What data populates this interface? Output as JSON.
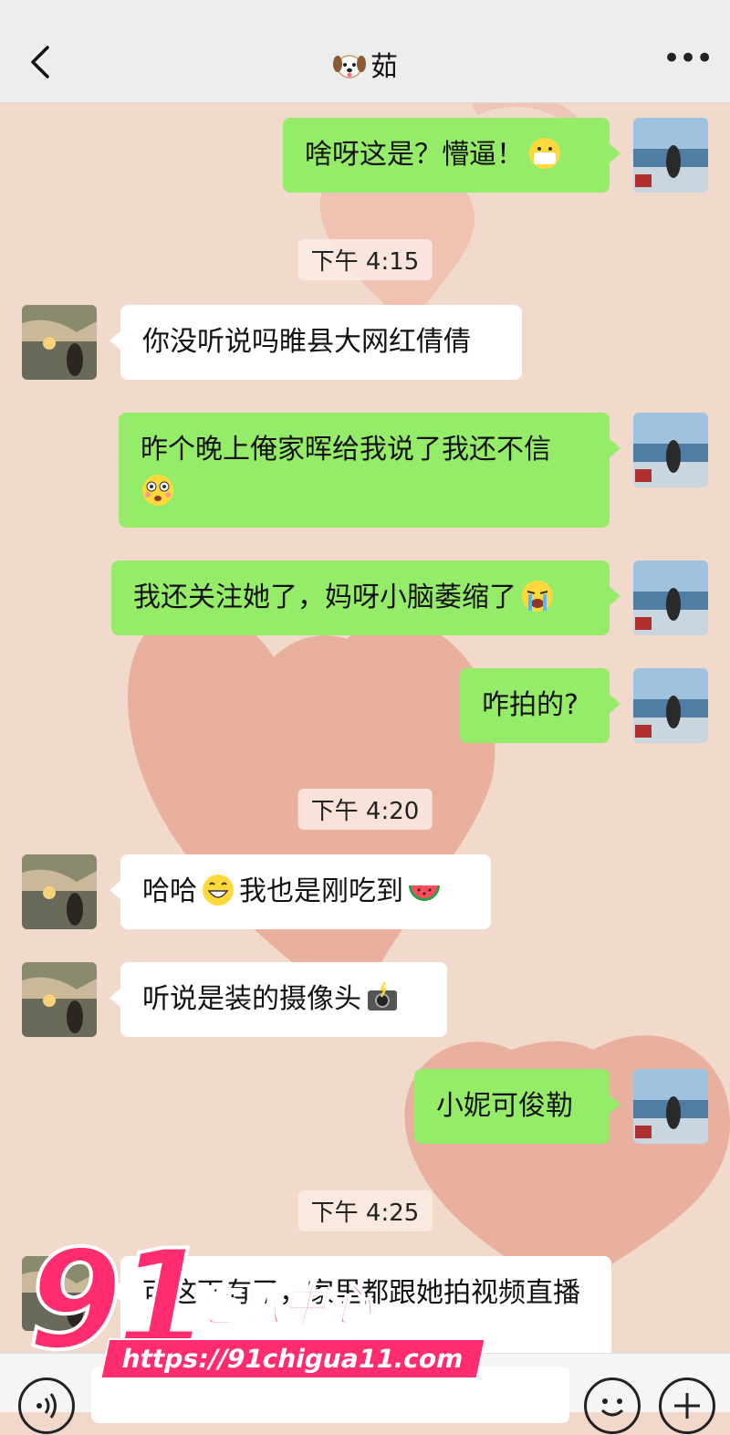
{
  "header": {
    "title": "茹",
    "title_icon": "dog-face-icon",
    "back_icon": "chevron-left-icon",
    "more_icon": "more-horizontal-icon"
  },
  "messages": [
    {
      "type": "out",
      "text": "啥呀这是？懵逼！",
      "emoji": "mask-face-emoji"
    },
    {
      "type": "time",
      "text": "下午 4:15"
    },
    {
      "type": "in",
      "text": "你没听说吗睢县大网红倩倩"
    },
    {
      "type": "out",
      "text": "昨个晚上俺家晖给我说了我还不信",
      "emoji": "flushed-face-emoji"
    },
    {
      "type": "out",
      "text": "我还关注她了，妈呀小脑萎缩了",
      "emoji": "crying-face-emoji"
    },
    {
      "type": "out",
      "text": "咋拍的?"
    },
    {
      "type": "time",
      "text": "下午 4:20"
    },
    {
      "type": "in",
      "text_before": "哈哈",
      "emoji_mid": "grinning-face-emoji",
      "text_after": "我也是刚吃到",
      "emoji": "watermelon-emoji"
    },
    {
      "type": "in",
      "text": "听说是装的摄像头",
      "emoji": "camera-flash-emoji"
    },
    {
      "type": "out",
      "text": "小妮可俊勒"
    },
    {
      "type": "time",
      "text": "下午 4:25"
    },
    {
      "type": "in",
      "text": "可这下有了，家里都跟她拍视频直播"
    }
  ],
  "bottom": {
    "voice_icon": "voice-icon",
    "emoji_icon": "smiley-icon",
    "plus_icon": "plus-circle-icon"
  },
  "watermark": {
    "logo": "91",
    "brand": "吃瓜中心",
    "url": "https://91chigua11.com"
  },
  "colors": {
    "outgoing": "#95ec69",
    "incoming": "#ffffff",
    "watermark": "#ff2d6f"
  }
}
